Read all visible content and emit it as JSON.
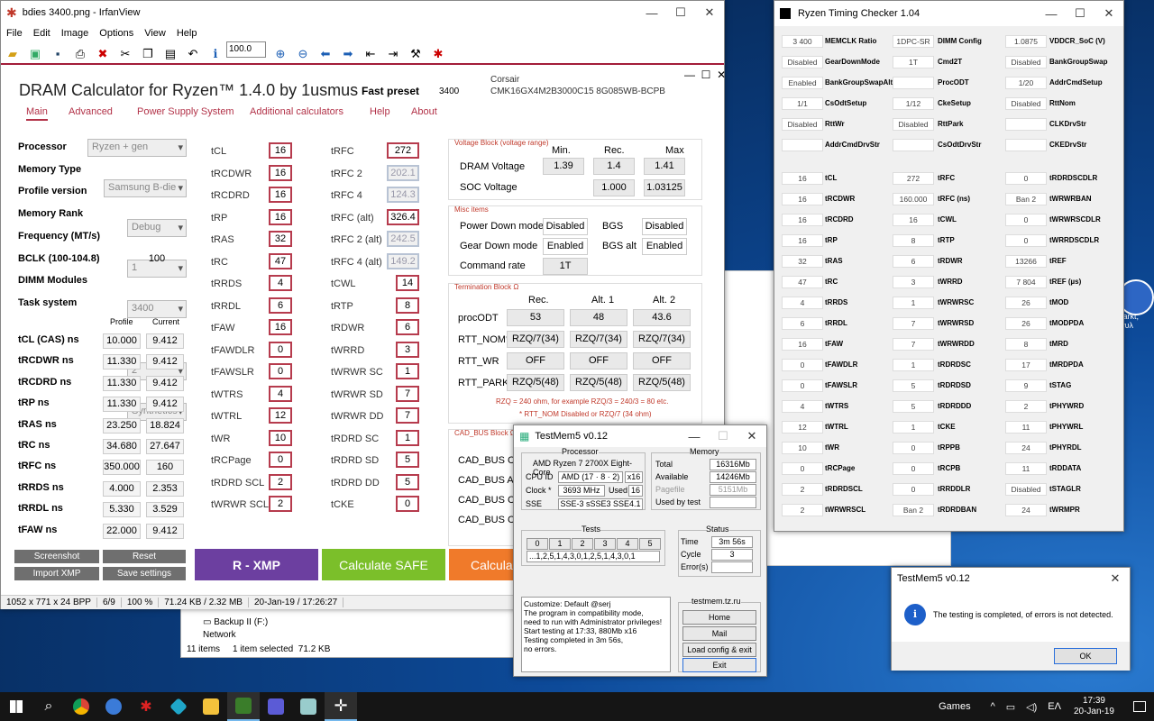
{
  "irfan": {
    "title": "bdies 3400.png - IrfanView",
    "menu": [
      "File",
      "Edit",
      "Image",
      "Options",
      "View",
      "Help"
    ],
    "zoom": "100.0",
    "status": [
      "1052 x 771 x 24 BPP",
      "6/9",
      "100 %",
      "71.24 KB / 2.32 MB",
      "20-Jan-19 / 17:26:27"
    ]
  },
  "dram": {
    "title": "DRAM Calculator for Ryzen™ 1.4.0 by 1usmus",
    "preset_label": "Fast preset",
    "preset_value": "3400",
    "kit_vendor": "Corsair",
    "kit_model": "CMK16GX4M2B3000C15 8G085WB-BCPB",
    "tabs": [
      "Main",
      "Advanced",
      "Power Supply System",
      "Additional calculators",
      "Help",
      "About"
    ],
    "settings": [
      {
        "label": "Processor",
        "value": "Ryzen + gen"
      },
      {
        "label": "Memory Type",
        "value": "Samsung B-die"
      },
      {
        "label": "Profile version",
        "value": "Debug"
      },
      {
        "label": "Memory Rank",
        "value": "1"
      },
      {
        "label": "Frequency (MT/s)",
        "value": "3400"
      },
      {
        "label": "BCLK (100-104.8)",
        "value": "100"
      },
      {
        "label": "DIMM Modules",
        "value": "2"
      },
      {
        "label": "Task system",
        "value": "Synthetics"
      }
    ],
    "col_profile": "Profile",
    "col_current": "Current",
    "ns": [
      {
        "label": "tCL (CAS) ns",
        "profile": "10.000",
        "current": "9.412"
      },
      {
        "label": "tRCDWR ns",
        "profile": "11.330",
        "current": "9.412"
      },
      {
        "label": "tRCDRD ns",
        "profile": "11.330",
        "current": "9.412"
      },
      {
        "label": "tRP ns",
        "profile": "11.330",
        "current": "9.412"
      },
      {
        "label": "tRAS ns",
        "profile": "23.250",
        "current": "18.824"
      },
      {
        "label": "tRC ns",
        "profile": "34.680",
        "current": "27.647"
      },
      {
        "label": "tRFC ns",
        "profile": "350.000",
        "current": "160"
      },
      {
        "label": "tRRDS ns",
        "profile": "4.000",
        "current": "2.353"
      },
      {
        "label": "tRRDL ns",
        "profile": "5.330",
        "current": "3.529"
      },
      {
        "label": "tFAW ns",
        "profile": "22.000",
        "current": "9.412"
      }
    ],
    "timings1": [
      {
        "label": "tCL",
        "value": "16"
      },
      {
        "label": "tRCDWR",
        "value": "16"
      },
      {
        "label": "tRCDRD",
        "value": "16"
      },
      {
        "label": "tRP",
        "value": "16"
      },
      {
        "label": "tRAS",
        "value": "32"
      },
      {
        "label": "tRC",
        "value": "47"
      },
      {
        "label": "tRRDS",
        "value": "4"
      },
      {
        "label": "tRRDL",
        "value": "6"
      },
      {
        "label": "tFAW",
        "value": "16"
      },
      {
        "label": "tFAWDLR",
        "value": "0"
      },
      {
        "label": "tFAWSLR",
        "value": "0"
      },
      {
        "label": "tWTRS",
        "value": "4"
      },
      {
        "label": "tWTRL",
        "value": "12"
      },
      {
        "label": "tWR",
        "value": "10"
      },
      {
        "label": "tRCPage",
        "value": "0"
      },
      {
        "label": "tRDRD SCL",
        "value": "2"
      },
      {
        "label": "tWRWR SCL",
        "value": "2"
      }
    ],
    "timings2": [
      {
        "label": "tRFC",
        "value": "272",
        "gray": false
      },
      {
        "label": "tRFC 2",
        "value": "202.1",
        "gray": true
      },
      {
        "label": "tRFC 4",
        "value": "124.3",
        "gray": true
      },
      {
        "label": "tRFC (alt)",
        "value": "326.4",
        "gray": false
      },
      {
        "label": "tRFC 2 (alt)",
        "value": "242.5",
        "gray": true
      },
      {
        "label": "tRFC 4 (alt)",
        "value": "149.2",
        "gray": true
      },
      {
        "label": "tCWL",
        "value": "14",
        "gray": false
      },
      {
        "label": "tRTP",
        "value": "8",
        "gray": false
      },
      {
        "label": "tRDWR",
        "value": "6",
        "gray": false
      },
      {
        "label": "tWRRD",
        "value": "3",
        "gray": false
      },
      {
        "label": "tWRWR SC",
        "value": "1",
        "gray": false
      },
      {
        "label": "tWRWR SD",
        "value": "7",
        "gray": false
      },
      {
        "label": "tWRWR DD",
        "value": "7",
        "gray": false
      },
      {
        "label": "tRDRD SC",
        "value": "1",
        "gray": false
      },
      {
        "label": "tRDRD SD",
        "value": "5",
        "gray": false
      },
      {
        "label": "tRDRD DD",
        "value": "5",
        "gray": false
      },
      {
        "label": "tCKE",
        "value": "0",
        "gray": false
      }
    ],
    "voltage": {
      "title": "Voltage Block (voltage range)",
      "h_min": "Min.",
      "h_rec": "Rec.",
      "h_max": "Max",
      "dram_label": "DRAM Voltage",
      "dram_min": "1.39",
      "dram_rec": "1.4",
      "dram_max": "1.41",
      "soc_label": "SOC Voltage",
      "soc_rec": "1.000",
      "soc_max": "1.03125"
    },
    "misc": {
      "title": "Misc items",
      "pdm_label": "Power Down mode",
      "pdm": "Disabled",
      "bgs_label": "BGS",
      "bgs": "Disabled",
      "gdm_label": "Gear Down mode",
      "gdm": "Enabled",
      "bgsalt_label": "BGS alt",
      "bgsalt": "Enabled",
      "cr_label": "Command rate",
      "cr": "1T"
    },
    "term": {
      "title": "Termination Block Ω",
      "h_rec": "Rec.",
      "h_alt1": "Alt. 1",
      "h_alt2": "Alt. 2",
      "rows": [
        {
          "label": "procODT",
          "v": [
            "53",
            "48",
            "43.6"
          ]
        },
        {
          "label": "RTT_NOM*",
          "v": [
            "RZQ/7(34)",
            "RZQ/7(34)",
            "RZQ/7(34)"
          ]
        },
        {
          "label": "RTT_WR",
          "v": [
            "OFF",
            "OFF",
            "OFF"
          ]
        },
        {
          "label": "RTT_PARK",
          "v": [
            "RZQ/5(48)",
            "RZQ/5(48)",
            "RZQ/5(48)"
          ]
        }
      ],
      "note1": "RZQ = 240 ohm, for example RZQ/3 = 240/3 = 80 etc.",
      "note2": "* RTT_NOM Disabled or RZQ/7 (34 ohm)"
    },
    "cad": {
      "title": "CAD_BUS Block Ω",
      "rows": [
        "CAD_BUS ClkD",
        "CAD_BUS Addr",
        "CAD_BUS CsOd",
        "CAD_BUS Cke"
      ]
    },
    "btn_screenshot": "Screenshot",
    "btn_reset": "Reset",
    "btn_import": "Import XMP",
    "btn_save": "Save settings",
    "btn_rxmp": "R - XMP",
    "btn_safe": "Calculate SAFE",
    "btn_calc": "Calculate"
  },
  "explorer": {
    "drive": "Backup II (F:)",
    "net": "Network",
    "items": "11 items",
    "selected": "1 item selected",
    "size": "71.2 KB"
  },
  "rtc": {
    "title": "Ryzen Timing Checker 1.04",
    "top": [
      [
        {
          "v": "3 400",
          "l": "MEMCLK Ratio"
        },
        {
          "v": "1DPC-SR",
          "l": "DIMM Config"
        },
        {
          "v": "1.0875",
          "l": "VDDCR_SoC (V)"
        }
      ],
      [
        {
          "v": "Disabled",
          "l": "GearDownMode"
        },
        {
          "v": "1T",
          "l": "Cmd2T"
        },
        {
          "v": "Disabled",
          "l": "BankGroupSwap"
        }
      ],
      [
        {
          "v": "Enabled",
          "l": "BankGroupSwapAlt"
        },
        {
          "v": "",
          "l": "ProcODT"
        },
        {
          "v": "1/20",
          "l": "AddrCmdSetup"
        }
      ],
      [
        {
          "v": "1/1",
          "l": "CsOdtSetup"
        },
        {
          "v": "1/12",
          "l": "CkeSetup"
        },
        {
          "v": "Disabled",
          "l": "RttNom"
        }
      ],
      [
        {
          "v": "Disabled",
          "l": "RttWr"
        },
        {
          "v": "Disabled",
          "l": "RttPark"
        },
        {
          "v": "",
          "l": "CLKDrvStr"
        }
      ],
      [
        {
          "v": "",
          "l": "AddrCmdDrvStr"
        },
        {
          "v": "",
          "l": "CsOdtDrvStr"
        },
        {
          "v": "",
          "l": "CKEDrvStr"
        }
      ]
    ],
    "bot": [
      [
        {
          "v": "16",
          "l": "tCL"
        },
        {
          "v": "272",
          "l": "tRFC"
        },
        {
          "v": "0",
          "l": "tRDRDSCDLR"
        }
      ],
      [
        {
          "v": "16",
          "l": "tRCDWR"
        },
        {
          "v": "160.000",
          "l": "tRFC (ns)"
        },
        {
          "v": "Ban 2",
          "l": "tWRWRBAN"
        }
      ],
      [
        {
          "v": "16",
          "l": "tRCDRD"
        },
        {
          "v": "16",
          "l": "tCWL"
        },
        {
          "v": "0",
          "l": "tWRWRSCDLR"
        }
      ],
      [
        {
          "v": "16",
          "l": "tRP"
        },
        {
          "v": "8",
          "l": "tRTP"
        },
        {
          "v": "0",
          "l": "tWRRDSCDLR"
        }
      ],
      [
        {
          "v": "32",
          "l": "tRAS"
        },
        {
          "v": "6",
          "l": "tRDWR"
        },
        {
          "v": "13266",
          "l": "tREF"
        }
      ],
      [
        {
          "v": "47",
          "l": "tRC"
        },
        {
          "v": "3",
          "l": "tWRRD"
        },
        {
          "v": "7 804",
          "l": "tREF (µs)"
        }
      ],
      [
        {
          "v": "4",
          "l": "tRRDS"
        },
        {
          "v": "1",
          "l": "tWRWRSC"
        },
        {
          "v": "26",
          "l": "tMOD"
        }
      ],
      [
        {
          "v": "6",
          "l": "tRRDL"
        },
        {
          "v": "7",
          "l": "tWRWRSD"
        },
        {
          "v": "26",
          "l": "tMODPDA"
        }
      ],
      [
        {
          "v": "16",
          "l": "tFAW"
        },
        {
          "v": "7",
          "l": "tWRWRDD"
        },
        {
          "v": "8",
          "l": "tMRD"
        }
      ],
      [
        {
          "v": "0",
          "l": "tFAWDLR"
        },
        {
          "v": "1",
          "l": "tRDRDSC"
        },
        {
          "v": "17",
          "l": "tMRDPDA"
        }
      ],
      [
        {
          "v": "0",
          "l": "tFAWSLR"
        },
        {
          "v": "5",
          "l": "tRDRDSD"
        },
        {
          "v": "9",
          "l": "tSTAG"
        }
      ],
      [
        {
          "v": "4",
          "l": "tWTRS"
        },
        {
          "v": "5",
          "l": "tRDRDDD"
        },
        {
          "v": "2",
          "l": "tPHYWRD"
        }
      ],
      [
        {
          "v": "12",
          "l": "tWTRL"
        },
        {
          "v": "1",
          "l": "tCKE"
        },
        {
          "v": "11",
          "l": "tPHYWRL"
        }
      ],
      [
        {
          "v": "10",
          "l": "tWR"
        },
        {
          "v": "0",
          "l": "tRPPB"
        },
        {
          "v": "24",
          "l": "tPHYRDL"
        }
      ],
      [
        {
          "v": "0",
          "l": "tRCPage"
        },
        {
          "v": "0",
          "l": "tRCPB"
        },
        {
          "v": "11",
          "l": "tRDDATA"
        }
      ],
      [
        {
          "v": "2",
          "l": "tRDRDSCL"
        },
        {
          "v": "0",
          "l": "tRRDDLR"
        },
        {
          "v": "Disabled",
          "l": "tSTAGLR"
        }
      ],
      [
        {
          "v": "2",
          "l": "tWRWRSCL"
        },
        {
          "v": "Ban 2",
          "l": "tRDRDBAN"
        },
        {
          "v": "24",
          "l": "tWRMPR"
        }
      ]
    ]
  },
  "tm": {
    "title": "TestMem5 v0.12",
    "proc_group": "Processor",
    "proc_name": "AMD Ryzen 7 2700X Eight-Core",
    "cpuid_label": "CPU ID",
    "cpuid": "AMD  (17 · 8 · 2)",
    "threads": "x16",
    "clock_label": "Clock *",
    "clock": "3693 MHz",
    "used_label": "Used",
    "used": "16",
    "sse_label": "SSE",
    "sse": "SSE-3 sSSE3 SSE4.1",
    "mem_group": "Memory",
    "total_label": "Total",
    "total": "16316Mb",
    "avail_label": "Available",
    "avail": "14246Mb",
    "pf_label": "Pagefile",
    "pf": "5151Mb",
    "ubt_label": "Used by test",
    "tests_group": "Tests",
    "tests": [
      "0",
      "1",
      "2",
      "3",
      "4",
      "5"
    ],
    "seq": "...1,2,5,1,4,3,0,1,2,5,1,4,3,0,1",
    "status_group": "Status",
    "time_label": "Time",
    "time": "3m 56s",
    "cycle_label": "Cycle",
    "cycle": "3",
    "err_label": "Error(s)",
    "log": "Customize: Default @serj\nThe program in compatibility mode,\nneed to run with Administrator privileges!\nStart testing at 17:33, 880Mb x16\nTesting completed in 3m 56s,\nno errors.",
    "site": "testmem.tz.ru",
    "btn_home": "Home",
    "btn_mail": "Mail",
    "btn_load": "Load config & exit",
    "btn_exit": "Exit"
  },
  "dlg": {
    "title": "TestMem5 v0.12",
    "msg": "The testing is completed, of errors is not detected.",
    "ok": "OK"
  },
  "taskbar": {
    "games": "Games",
    "lang": "ΕΛ",
    "time": "17:39",
    "date": "20-Jan-19"
  },
  "desktop": {
    "icon_label": "Markt, ργυλ"
  }
}
